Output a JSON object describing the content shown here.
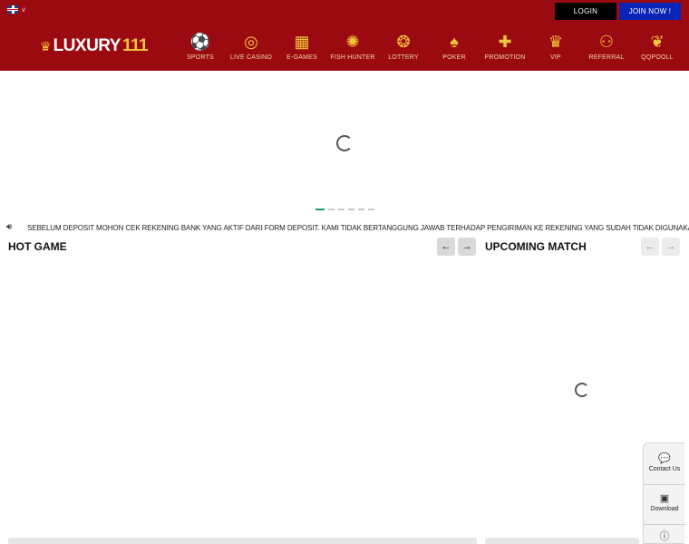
{
  "header": {
    "language_icon": "uk-flag-icon",
    "language_chevron": "v",
    "login_label": "LOGIN",
    "join_label": "JOIN NOW !",
    "logo_word": "LUXURY",
    "logo_number": "111",
    "logo_icon": "crown-icon"
  },
  "nav": {
    "items": [
      {
        "label": "SPORTS",
        "icon": "⚽"
      },
      {
        "label": "LIVE CASINO",
        "icon": "◎"
      },
      {
        "label": "E-GAMES",
        "icon": "▦"
      },
      {
        "label": "FISH HUNTER",
        "icon": "✺"
      },
      {
        "label": "LOTTERY",
        "icon": "❂"
      },
      {
        "label": "POKER",
        "icon": "♠"
      },
      {
        "label": "PROMOTION",
        "icon": "✚"
      },
      {
        "label": "VIP",
        "icon": "♛"
      },
      {
        "label": "REFERRAL",
        "icon": "⚇"
      },
      {
        "label": "QQPOOLL",
        "icon": "❦"
      }
    ]
  },
  "banner": {
    "slide_count": 6,
    "active_slide": 1
  },
  "announcement": {
    "icon": "speaker-icon",
    "text": "SEBELUM DEPOSIT MOHON CEK REKENING BANK YANG AKTIF DARI FORM DEPOSIT. KAMI TIDAK BERTANGGUNG JAWAB TERHADAP PENGIRIMAN KE REKENING YANG SUDAH TIDAK DIGUNAKAN"
  },
  "hot_game": {
    "title": "HOT GAME",
    "prev_icon": "←",
    "next_icon": "→"
  },
  "upcoming_match": {
    "title": "UPCOMING MATCH",
    "prev_icon": "←",
    "next_icon": "→"
  },
  "side_widget": {
    "contact_label": "Contact Us",
    "contact_icon": "💬",
    "download_label": "Download",
    "download_icon": "▣",
    "info_icon": "ⓘ"
  },
  "colors": {
    "header_bg": "#9b0a10",
    "gold": "#f3c53a",
    "join_bg": "#0a23b8",
    "login_bg": "#000000"
  }
}
